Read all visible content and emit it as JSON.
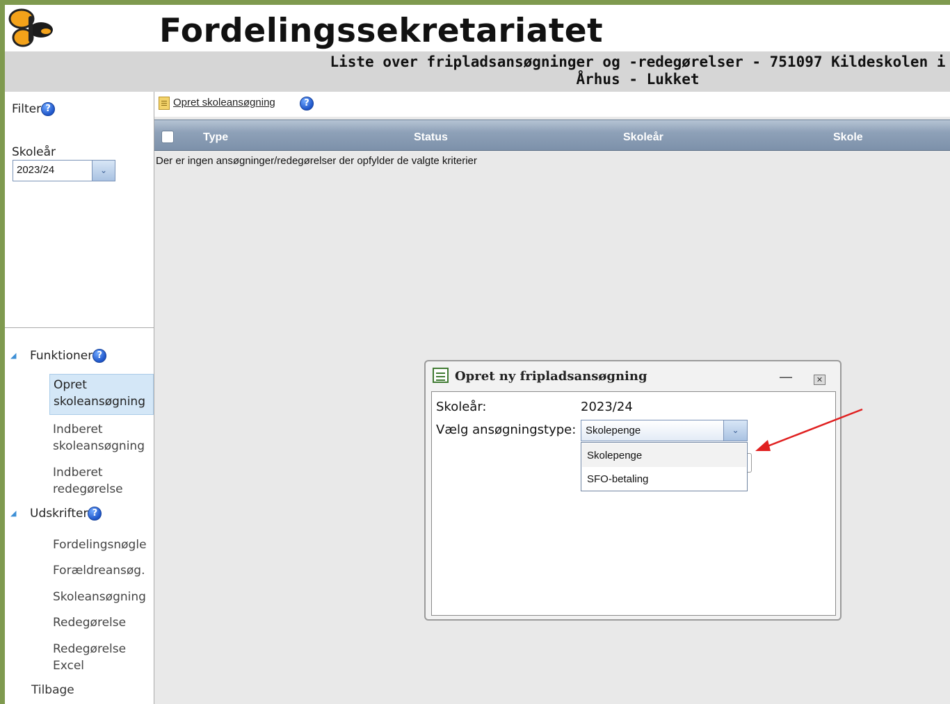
{
  "app_title": "Fordelingssekretariatet",
  "page_subtitle": "Liste over fripladsansøgninger og -redegørelser - 751097 Kildeskolen i Århus - Lukket",
  "help_glyph": "?",
  "sidebar": {
    "filter_label": "Filter",
    "skolear_label": "Skoleår",
    "skolear_value": "2023/24",
    "sections": [
      {
        "label": "Funktioner",
        "items": [
          "Opret skoleansøgning",
          "Indberet skoleansøgning",
          "Indberet redegørelse"
        ]
      },
      {
        "label": "Udskrifter",
        "items": [
          "Fordelingsnøgle",
          "Forældreansøg.",
          "Skoleansøgning",
          "Redegørelse",
          "Redegørelse Excel"
        ]
      }
    ],
    "back_label": "Tilbage"
  },
  "toolbar": {
    "create_link": "Opret skoleansøgning"
  },
  "grid": {
    "columns": [
      "Type",
      "Status",
      "Skoleår",
      "Skole"
    ],
    "empty_message": "Der er ingen ansøgninger/redegørelser der opfylder de valgte kriterier"
  },
  "dialog": {
    "title": "Opret ny fripladsansøgning",
    "minimize_glyph": "—",
    "close_glyph": "✕",
    "skolear_label": "Skoleår:",
    "skolear_value": "2023/24",
    "type_label": "Vælg ansøgningstype:",
    "type_value": "Skolepenge",
    "options": [
      "Skolepenge",
      "SFO-betaling"
    ]
  },
  "colors": {
    "accent_green": "#7f9a4f",
    "header_gray": "#d6d6d6",
    "grid_header": "#8ea1b8",
    "arrow_red": "#e02020"
  }
}
